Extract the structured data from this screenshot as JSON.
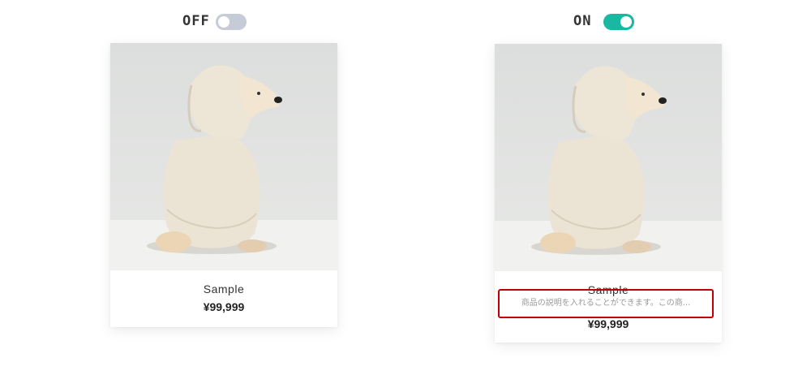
{
  "left_panel": {
    "toggle_label": "OFF",
    "toggle_state": "off",
    "product": {
      "name": "Sample",
      "price": "¥99,999"
    }
  },
  "right_panel": {
    "toggle_label": "ON",
    "toggle_state": "on",
    "product": {
      "name": "Sample",
      "description": "商品の説明を入れることができます。この商...",
      "price": "¥99,999"
    }
  },
  "colors": {
    "toggle_on": "#19b8a3",
    "toggle_off": "#c5ccd8",
    "highlight_border": "#c00000"
  },
  "icons": {
    "product_image": "dog-in-hoodie-photo"
  }
}
